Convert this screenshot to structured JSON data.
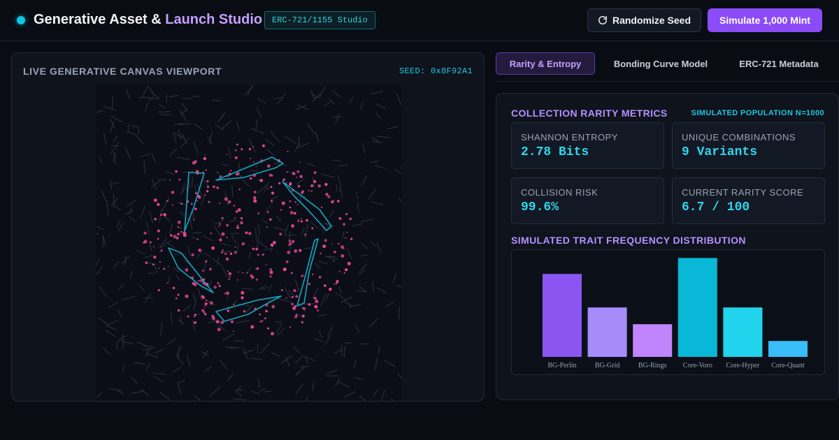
{
  "header": {
    "brand_part1": "Generative Asset & ",
    "brand_part2": "Launch Studio",
    "standard_badge": "ERC-721/1155 Studio",
    "randomize_label": "Randomize Seed",
    "simulate_label": "Simulate 1,000 Mint"
  },
  "canvas": {
    "title": "LIVE GENERATIVE CANVAS VIEWPORT",
    "seed": "SEED: 0x8F92A1"
  },
  "tabs": [
    {
      "label": "Rarity & Entropy",
      "active": true
    },
    {
      "label": "Bonding Curve Model",
      "active": false
    },
    {
      "label": "ERC-721 Metadata",
      "active": false
    }
  ],
  "metrics": {
    "title": "COLLECTION RARITY METRICS",
    "population": "SIMULATED POPULATION N=1000",
    "cards": [
      {
        "label": "SHANNON ENTROPY",
        "value": "2.78 Bits"
      },
      {
        "label": "UNIQUE COMBINATIONS",
        "value": "9 Variants"
      },
      {
        "label": "COLLISION RISK",
        "value": "99.6%"
      },
      {
        "label": "CURRENT RARITY SCORE",
        "value": "6.7 / 100"
      }
    ],
    "distribution_title": "SIMULATED TRAIT FREQUENCY DISTRIBUTION"
  },
  "chart_data": {
    "type": "bar",
    "categories": [
      "BG-Perlin",
      "BG-Grid",
      "BG-Rings",
      "Core-Voro",
      "Core-Hyper",
      "Core-Quant"
    ],
    "values": [
      198,
      118,
      78,
      236,
      118,
      38
    ],
    "colors": [
      "#8b55f2",
      "#a78bfa",
      "#c084fc",
      "#08b8d6",
      "#22d3ee",
      "#38bdf8"
    ]
  },
  "icons": {
    "randomize": "refresh-icon",
    "status": "status-dot-icon"
  },
  "colors": {
    "accent_purple": "#8b4cf7",
    "accent_cyan": "#1ec8e0",
    "dot_pink": "#ec4899"
  }
}
